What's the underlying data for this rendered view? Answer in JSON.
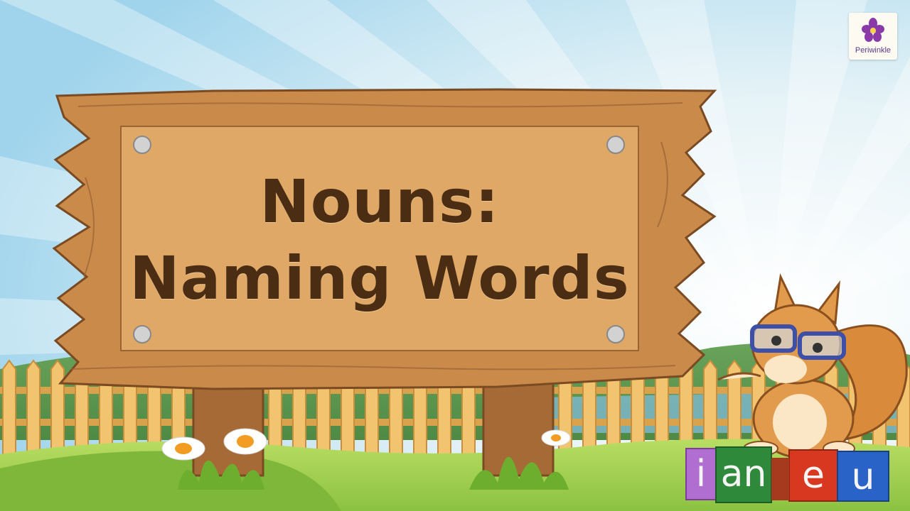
{
  "sign": {
    "title_line1": "Nouns:",
    "title_line2": "Naming Words"
  },
  "logo": {
    "brand": "Periwinkle",
    "icon": "periwinkle-flower-icon"
  },
  "blocks": [
    {
      "letter": "i",
      "color": "#b06fd0"
    },
    {
      "letter": "an",
      "color": "#2e8a3a"
    },
    {
      "letter": "e",
      "color": "#d8381f"
    },
    {
      "letter": "u",
      "color": "#2a63c8"
    }
  ],
  "colors": {
    "sky": "#bfe4f3",
    "wood": "#c98a4a",
    "plank": "#dfa866",
    "grass": "#9ccf4e",
    "text": "#4a2d12"
  }
}
